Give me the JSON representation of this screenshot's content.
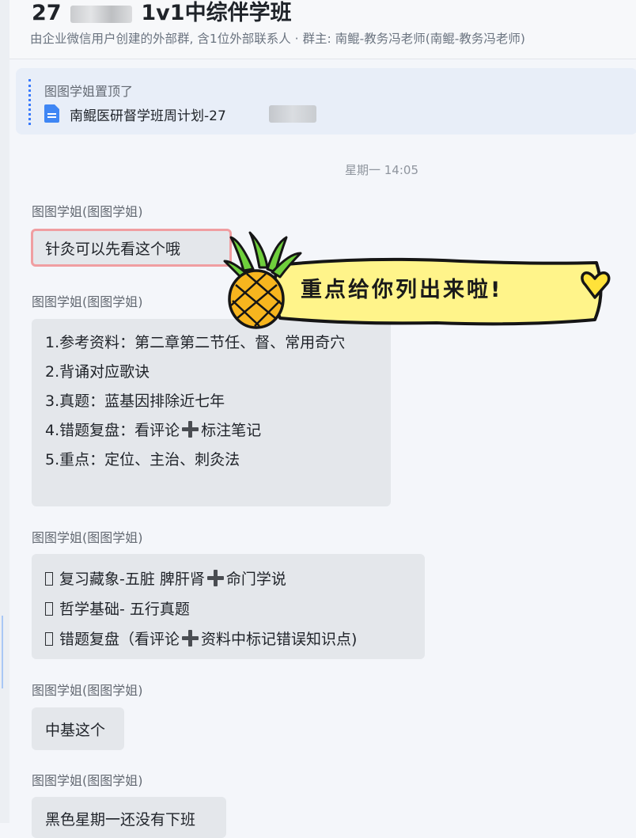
{
  "chat": {
    "title_prefix": "27",
    "title_suffix": "1v1中综伴学班",
    "subtitle": "由企业微信用户创建的外部群, 含1位外部联系人 · 群主: 南鲲-教务冯老师(南鲲-教务冯老师)"
  },
  "pinned": {
    "label": "图图学姐置顶了",
    "doc_title": "南鲲医研督学班周计划-27"
  },
  "divider": {
    "time": "星期一 14:05"
  },
  "messages": [
    {
      "sender": "图图学姐(图图学姐)",
      "text": "针灸可以先看这个哦"
    },
    {
      "sender": "图图学姐(图图学姐)",
      "lines": [
        "1.参考资料：第二章第二节任、督、常用奇穴",
        "2.背诵对应歌诀",
        "3.真题：蓝基因排除近七年",
        {
          "a": "4.错题复盘：看评论",
          "b": "标注笔记"
        },
        "5.重点：定位、主治、刺灸法"
      ]
    },
    {
      "sender": "图图学姐(图图学姐)",
      "lines": [
        {
          "a": "复习藏象-五脏 脾肝肾",
          "b": "命门学说"
        },
        {
          "a": "哲学基础- 五行真题"
        },
        {
          "a": "错题复盘（看评论",
          "b": "资料中标记错误知识点)"
        }
      ]
    },
    {
      "sender": "图图学姐(图图学姐)",
      "text": "中基这个"
    },
    {
      "sender": "图图学姐(图图学姐)",
      "text": "黑色星期一还没有下班"
    }
  ],
  "sticker": {
    "text": "重点给你列出来啦!",
    "colors": {
      "banner": "#fff48a",
      "heart": "#ffe23a",
      "pineapple_body": "#f7b51e",
      "pineapple_leaves": "#6fcf3c"
    }
  },
  "icons": {
    "plus": "heavy-plus-sign-emoji",
    "box": "missing-glyph-box",
    "doc": "document-icon"
  },
  "colors": {
    "background": "#f4f6fa",
    "bubble": "#e4e7eb",
    "pinned_bg": "#e8eef8",
    "accent": "#3a7bfd",
    "highlight_outline": "#f09ea1"
  }
}
